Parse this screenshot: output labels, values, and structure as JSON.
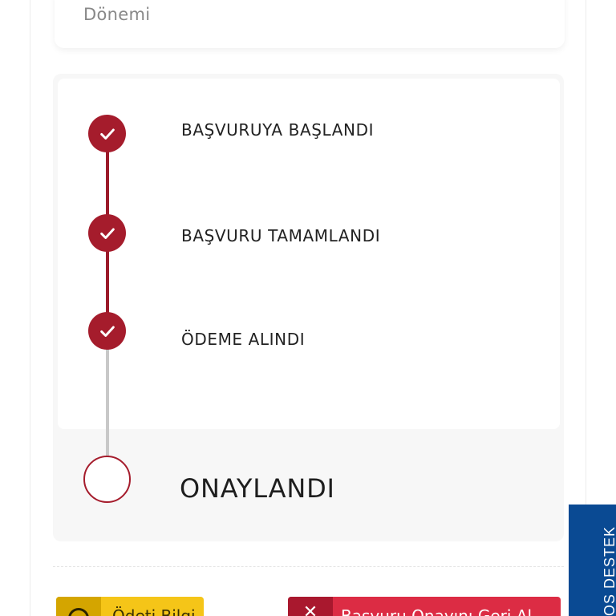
{
  "top_card": {
    "label": "Dönemi"
  },
  "timeline": {
    "steps": [
      {
        "label": "BAŞVURUYA BAŞLANDI",
        "status": "completed",
        "icon": "check-icon"
      },
      {
        "label": "BAŞVURU TAMAMLANDI",
        "status": "completed",
        "icon": "check-icon"
      },
      {
        "label": "ÖDEME ALINDI",
        "status": "completed",
        "icon": "check-icon"
      },
      {
        "label": "ONAYLANDI",
        "status": "pending",
        "icon": "empty-circle-icon"
      }
    ]
  },
  "actions": {
    "info_button_label": "Ödeti Bilgi",
    "revoke_button_label": "Başvuru Onayını Geri Al"
  },
  "support_tab": {
    "label": "OS DESTEK"
  },
  "colors": {
    "accent_red": "#a51c2c",
    "pending_line": "#c8c8c8",
    "info_yellow": "#f5c518",
    "revoke_red": "#dc2c44",
    "support_blue": "#0a4a93"
  }
}
